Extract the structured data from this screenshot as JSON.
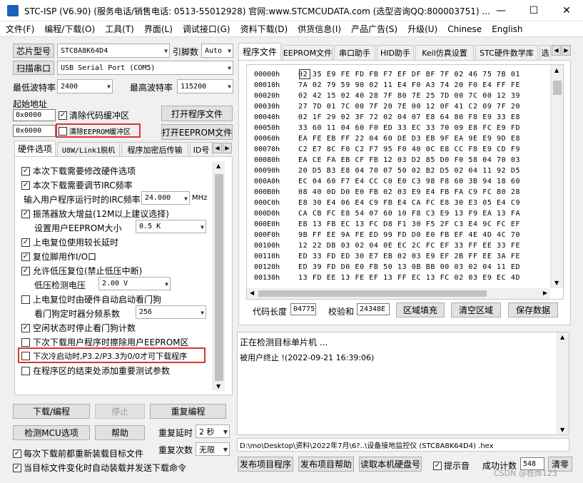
{
  "window": {
    "title": "STC-ISP (V6.90) (服务电话/销售电话: 0513-55012928) 官网:www.STCMCUDATA.com (选型咨询QQ:800003751) ...",
    "minimize": "—",
    "maximize": "☐",
    "close": "✕"
  },
  "menu": [
    "文件(F)",
    "编程/下载(O)",
    "工具(T)",
    "界面(L)",
    "调试接口(G)",
    "资料下载(D)",
    "供货信息(I)",
    "产品广告(S)",
    "升级(U)",
    "Chinese",
    "English"
  ],
  "left": {
    "chip_label": "芯片型号",
    "chip_value": "STC8A8K64D4",
    "pins_label": "引脚数",
    "pins_value": "Auto",
    "scan_label": "扫描串口",
    "port_value": "USB Serial Port (COM5)",
    "min_baud_label": "最低波特率",
    "min_baud": "2400",
    "max_baud_label": "最高波特率",
    "max_baud": "115200",
    "start_addr_label": "起始地址",
    "addr1": "0x0000",
    "clear_code": "清除代码缓冲区",
    "open_prog": "打开程序文件",
    "addr2": "0x0000",
    "clear_eeprom": "清除EEPROM缓冲区",
    "open_eeprom": "打开EEPROM文件",
    "tabs": [
      "硬件选项",
      "U8W/Link1脱机",
      "程序加密后传输",
      "ID号"
    ],
    "options": [
      {
        "label": "本次下载需要修改硬件选项",
        "checked": true
      },
      {
        "label": "本次下载需要调节IRC频率",
        "checked": true
      },
      {
        "label": "输入用户程序运行时的IRC频率",
        "value": "24.000",
        "unit": "MHz"
      },
      {
        "label": "振荡器放大增益(12M以上建议选择)",
        "checked": true
      },
      {
        "label": "设置用户EEPROM大小",
        "value": "0.5 K"
      },
      {
        "label": "上电复位使用较长延时",
        "checked": true
      },
      {
        "label": "复位脚用作I/O口",
        "checked": true
      },
      {
        "label": "允许低压复位(禁止低压中断)",
        "checked": true
      },
      {
        "label": "低压检测电压",
        "value": "2.00 V"
      },
      {
        "label": "上电复位时由硬件自动启动看门狗",
        "checked": false
      },
      {
        "label": "看门狗定时器分频系数",
        "value": "256"
      },
      {
        "label": "空闲状态时停止看门狗计数",
        "checked": true
      },
      {
        "label": "下次下载用户程序时擦除用户EEPROM区",
        "checked": false
      },
      {
        "label": "下次冷启动时,P3.2/P3.3为0/0才可下载程序",
        "checked": false
      },
      {
        "label": "在程序区的结束处添加重要测试参数",
        "checked": false
      }
    ],
    "download": "下载/编程",
    "stop": "停止",
    "reprogram": "重复编程",
    "check_mcu": "检测MCU选项",
    "help": "帮助",
    "repeat_delay_label": "重复延时",
    "repeat_delay": "2 秒",
    "repeat_count_label": "重复次数",
    "repeat_count": "无限",
    "reload_before": "每次下载前都重新装载目标文件",
    "auto_send": "当目标文件变化时自动装载并发送下载命令"
  },
  "right": {
    "tabs": [
      "程序文件",
      "EEPROM文件",
      "串口助手",
      "HID助手",
      "Keil仿真设置",
      "STC硬件数学库",
      "选"
    ],
    "hex_rows": [
      [
        "00000h",
        "02 35 E9 FE FD FB F7 EF DF BF 7F 02 46 75 7B 01"
      ],
      [
        "00010h",
        "7A 02 79 59 90 02 11 E4 F0 A3 74 20 F0 E4 FF FE"
      ],
      [
        "00020h",
        "02 42 15 02 40 28 7F 80 7E 25 7D 00 7C 00 12 39"
      ],
      [
        "00030h",
        "27 7D 01 7C 00 7F 20 7E 00 12 0F 41 C2 09 7F 20"
      ],
      [
        "00040h",
        "02 1F 29 02 3F 72 02 04 07 E8 64 80 F8 E9 33 E8"
      ],
      [
        "00050h",
        "33 60 11 04 60 F0 ED 33 EC 33 70 09 E8 FC E9 FD"
      ],
      [
        "00060h",
        "EA FE EB FF 22 04 60 DE D3 EB 9F EA 9E E9 9D E8"
      ],
      [
        "00070h",
        "C2 E7 8C F0 C2 F7 95 F0 40 0C E8 CC F8 E9 CD F9"
      ],
      [
        "00080h",
        "EA CE FA EB CF FB 12 03 D2 85 D0 F0 58 04 70 03"
      ],
      [
        "00090h",
        "20 D5 B3 E8 04 70 07 50 02 B2 D5 02 04 11 92 D5"
      ],
      [
        "000A0h",
        "EC 04 60 F7 E4 CC C0 E0 C3 98 F8 60 3B 94 18 60"
      ],
      [
        "000B0h",
        "08 40 0D D0 E0 FB 02 03 E9 E4 FB FA C9 FC 80 28"
      ],
      [
        "000C0h",
        "E8 30 E4 06 E4 C9 FB E4 CA FC E8 30 E3 05 E4 C9"
      ],
      [
        "000D0h",
        "CA CB FC E8 54 07 60 10 F8 C3 E9 13 F9 EA 13 FA"
      ],
      [
        "000E0h",
        "EB 13 FB EC 13 FC D8 F1 30 F5 2F C3 E4 9C FC EF"
      ],
      [
        "000F0h",
        "9B FF EE 9A FE ED 99 FD D0 E0 FB EF 4E 4D 4C 70"
      ],
      [
        "00100h",
        "12 22 DB 03 02 04 0E EC 2C FC EF 33 FF EE 33 FE"
      ],
      [
        "00110h",
        "ED 33 FD ED 30 E7 EB 02 03 E9 EF 2B FF EE 3A FE"
      ],
      [
        "00120h",
        "ED 39 FD D0 E0 FB 50 13 0B BB 00 03 02 04 11 ED"
      ],
      [
        "00130h",
        "13 FD EE 13 FE EF 13 FF EC 13 FC 02 03 E9 EC 4D"
      ]
    ],
    "code_len_label": "代码长度",
    "code_len": "04775",
    "checksum_label": "校验和",
    "checksum": "24348E",
    "fill_btn": "区域填充",
    "clear_btn": "清空区域",
    "save_btn": "保存数据",
    "status_lines": [
      "正在检测目标单片机 ...",
      "被用户终止 !(2022-09-21 16:39:06)"
    ],
    "file_path": "D:\\mo\\Desktop\\资料\\2022年7月\\6?..\\设备接地监控仪 (STC8A8K64D4) .hex",
    "publish": "发布项目程序",
    "publish_help": "发布项目帮助",
    "read_disk": "读取本机硬盘号",
    "sound": "提示音",
    "success_label": "成功计数",
    "success_count": "548",
    "clear": "清零",
    "watermark": "CSDN @桂烨123"
  }
}
